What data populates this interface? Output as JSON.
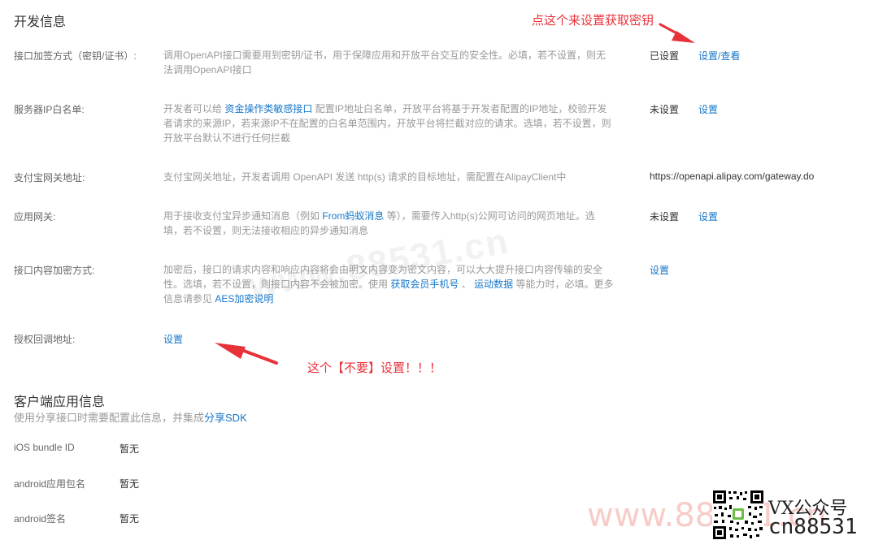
{
  "dev": {
    "title": "开发信息",
    "rows": [
      {
        "label": "接口加签方式（密钥/证书）:",
        "desc_lines": [
          "调用OpenAPI接口需要用到密钥/证书，用于保障应用和开放平台交互的安全性。必填，若不设置，则无",
          "法调用OpenAPI接口"
        ],
        "status": "已设置",
        "action": "设置/查看"
      },
      {
        "label": "服务器IP白名单:",
        "desc_l1_pre": "开发者可以给",
        "desc_l1_link": "资金操作类敏感接口",
        "desc_l1_post": "配置IP地址白名单，开放平台将基于开发者配置的IP地址，校验开发",
        "desc_l2": "者请求的来源IP，若来源IP不在配置的白名单范围内，开放平台将拦截对应的请求。选填，若不设置，则",
        "desc_l3": "开放平台默认不进行任何拦截",
        "status": "未设置",
        "action": "设置"
      },
      {
        "label": "支付宝网关地址:",
        "desc": "支付宝网关地址，开发者调用 OpenAPI 发送 http(s) 请求的目标地址，需配置在AlipayClient中",
        "value": "https://openapi.alipay.com/gateway.do"
      },
      {
        "label": "应用网关:",
        "desc_l1_pre": "用于接收支付宝异步通知消息（例如",
        "desc_l1_link": "From蚂蚁消息",
        "desc_l1_post": "等），需要传入http(s)公网可访问的网页地址。选",
        "desc_l2": "填，若不设置，则无法接收相应的异步通知消息",
        "status": "未设置",
        "action": "设置"
      },
      {
        "label": "接口内容加密方式:",
        "desc_l1": "加密后，接口的请求内容和响应内容将会由明文内容变为密文内容，可以大大提升接口内容传输的安全",
        "desc_l2_pre": "性。选填，若不设置，则接口内容不会被加密。使用",
        "desc_l2_link1": "获取会员手机号",
        "desc_l2_sep": "、",
        "desc_l2_link2": "运动数据",
        "desc_l2_post": "等能力时，必填。更多",
        "desc_l3_pre": "信息请参见",
        "desc_l3_link": "AES加密说明",
        "action": "设置"
      },
      {
        "label": "授权回调地址:",
        "action": "设置"
      }
    ]
  },
  "annotations": {
    "top": "点这个来设置获取密钥",
    "bottom": "这个【不要】设置！！！"
  },
  "client": {
    "title": "客户端应用信息",
    "subtitle_pre": "使用分享接口时需要配置此信息，并集成",
    "subtitle_link": "分享SDK",
    "rows": [
      {
        "label": "iOS bundle ID",
        "value": "暂无"
      },
      {
        "label": "android应用包名",
        "value": "暂无"
      },
      {
        "label": "android签名",
        "value": "暂无"
      }
    ]
  },
  "watermark": {
    "center": "www.88531.cn",
    "bottom": "www.88531.cn",
    "brand_line1": "VX公众号",
    "brand_line2": "cn88531"
  },
  "colors": {
    "link": "#1677c9",
    "annotation": "#e8323a",
    "muted": "#999999"
  }
}
